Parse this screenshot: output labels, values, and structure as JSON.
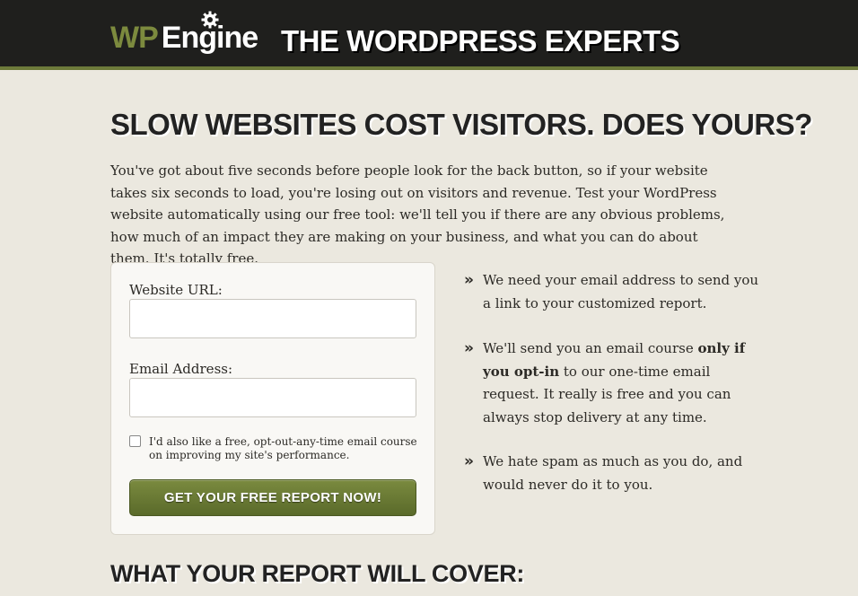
{
  "header": {
    "logo_wp": "WP",
    "logo_engine": "Engine",
    "tagline": "THE WORDPRESS EXPERTS"
  },
  "main": {
    "headline": "SLOW WEBSITES COST VISITORS. DOES YOURS?",
    "intro": "You've got about five seconds before people look for the back button, so if your website takes six seconds to load, you're losing out on visitors and revenue. Test your WordPress website automatically using our free tool: we'll tell you if there are any obvious problems, how much of an impact they are making on your business, and what you can do about them. It's totally free."
  },
  "form": {
    "url_label": "Website URL:",
    "url_value": "",
    "email_label": "Email Address:",
    "email_value": "",
    "optin_label": "I'd also like a free, opt-out-any-time email course on improving my site's performance.",
    "submit_label": "GET YOUR FREE REPORT NOW!"
  },
  "notes": {
    "bullet_glyph": "»",
    "n1": "We need your email address to send you a link to your customized report.",
    "n2_pre": "We'll send you an email course ",
    "n2_bold": "only if you opt-in",
    "n2_post": " to our one-time email request. It really is free and you can always stop delivery at any time.",
    "n3": "We hate spam as much as you do, and would never do it to you."
  },
  "sections": {
    "report_heading": "WHAT YOUR REPORT WILL COVER:"
  },
  "colors": {
    "brand_green": "#7c8a3e",
    "header_bg": "#1f1f1d",
    "page_bg": "#ebe8df"
  }
}
